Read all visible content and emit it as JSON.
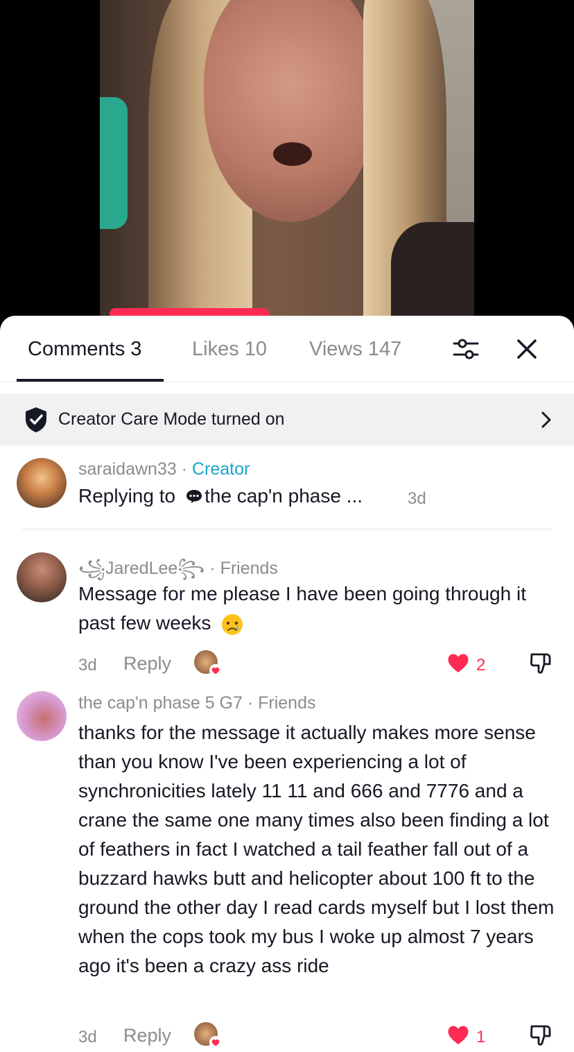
{
  "tabs": {
    "comments": "Comments 3",
    "likes": "Likes 10",
    "views": "Views 147"
  },
  "banner": {
    "text": "Creator Care Mode turned on"
  },
  "comments": [
    {
      "username": "saraidawn33",
      "separator": " · ",
      "badge": "Creator",
      "reply_prefix": "Replying to",
      "reply_target": "the cap'n phase ...",
      "time": "3d"
    },
    {
      "username": "꧁JaredLee꧂",
      "separator": " · ",
      "badge": "Friends",
      "text": "Message for me please I have been going through it past few weeks",
      "emoji": "crying-face",
      "time": "3d",
      "reply_label": "Reply",
      "likes": "2"
    },
    {
      "username": "the cap'n phase 5 G7",
      "separator": " · ",
      "badge": "Friends",
      "text": "thanks for the message it actually makes more sense than you know I've been experiencing a lot of synchronicities lately 11 11 and 666 and 7776 and a crane the same one many times also been finding a lot of feathers in fact I watched a tail feather fall out of a buzzard hawks butt and helicopter about 100 ft to the ground the other day I read cards myself but I lost them when the cops took my bus I woke up almost 7 years ago it's been a crazy ass ride",
      "time": "3d",
      "reply_label": "Reply",
      "likes": "1"
    }
  ],
  "colors": {
    "accent_red": "#fe2c55",
    "creator_blue": "#1ba3c9",
    "text_primary": "#161823",
    "text_secondary": "#8a8b91",
    "banner_bg": "#f1f1f2"
  }
}
